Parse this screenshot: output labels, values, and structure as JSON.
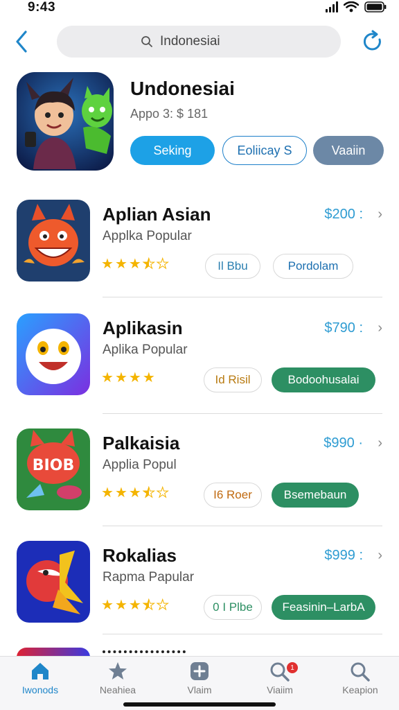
{
  "status": {
    "time": "9:43"
  },
  "search": {
    "value": "Indonesiai"
  },
  "featured": {
    "title": "Undonesiai",
    "subtitle": "Appo 3: $ 181",
    "buttons": [
      "Seking",
      "Eoliicay S",
      "Vaaiin"
    ]
  },
  "apps": [
    {
      "name": "Aplian Asian",
      "category": "Applka Popular",
      "price": "$200 :",
      "rating": 3.5,
      "tag1": "Il Bbu",
      "tag2": "Pordolam",
      "tag2_style": "pill"
    },
    {
      "name": "Aplikasin",
      "category": "Aplika Popular",
      "price": "$790 :",
      "rating": 4,
      "tag1": "Id Risil",
      "tag2": "Bodoohusalai",
      "tag2_style": "green"
    },
    {
      "name": "Palkaisia",
      "category": "Applia Popul",
      "price": "$990 ·",
      "rating": 3.5,
      "tag1": "I6 Roer",
      "tag2": "Bsemebaun",
      "tag2_style": "green"
    },
    {
      "name": "Rokalias",
      "category": "Rapma Papular",
      "price": "$999 :",
      "rating": 3.5,
      "tag1": "0 I Plbe",
      "tag2": "Feasinin–LarbA",
      "tag2_style": "green"
    }
  ],
  "tabs": [
    {
      "label": "Iwonods",
      "icon": "home-icon",
      "active": true
    },
    {
      "label": "Neahiea",
      "icon": "star-icon"
    },
    {
      "label": "Vlaim",
      "icon": "plus-square-icon"
    },
    {
      "label": "Viaiim",
      "icon": "search-badge-icon",
      "badge": "1"
    },
    {
      "label": "Keapion",
      "icon": "search-icon"
    }
  ],
  "colors": {
    "accent": "#1da1e6",
    "green": "#2d8f63",
    "price": "#2e9cd2",
    "star": "#f4b400"
  }
}
